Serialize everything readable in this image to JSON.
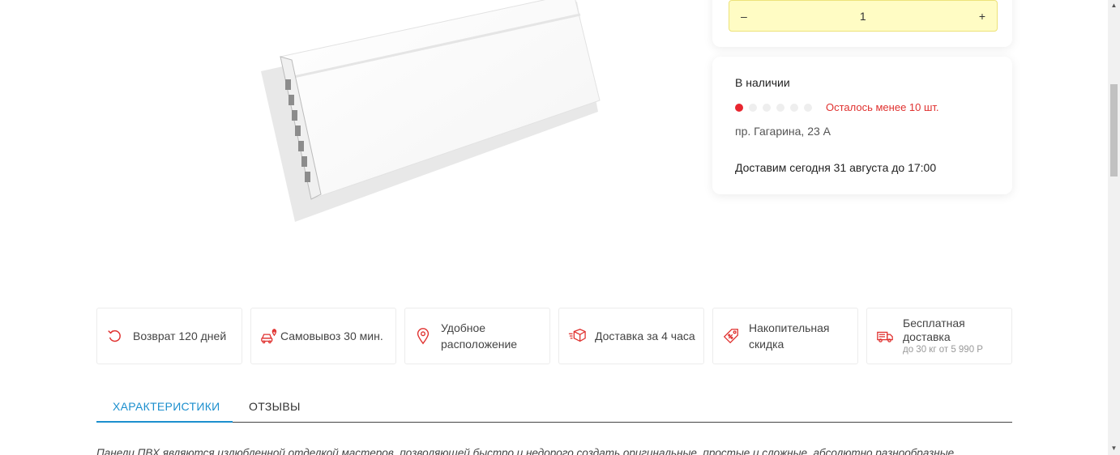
{
  "quantity": {
    "minus_label": "–",
    "value": "1",
    "plus_label": "+"
  },
  "stock": {
    "title": "В наличии",
    "level_dots_total": 6,
    "level_dots_filled": 1,
    "warning": "Осталось менее 10 шт.",
    "address": "пр. Гагарина, 23 А",
    "delivery": "Доставим сегодня 31 августа до 17:00"
  },
  "features": [
    {
      "icon": "return-icon",
      "label": "Возврат 120 дней"
    },
    {
      "icon": "car-pin-icon",
      "label": "Самовывоз 30 мин."
    },
    {
      "icon": "location-pin-icon",
      "label": "Удобное расположение"
    },
    {
      "icon": "box-fast-icon",
      "label": "Доставка за 4 часа"
    },
    {
      "icon": "discount-tag-icon",
      "label": "Накопительная скидка"
    },
    {
      "icon": "truck-icon",
      "label": "Бесплатная доставка",
      "sub": "до 30 кг от 5 990 Р"
    }
  ],
  "tabs": [
    {
      "label": "ХАРАКТЕРИСТИКИ",
      "active": true
    },
    {
      "label": "ОТЗЫВЫ",
      "active": false
    }
  ],
  "description": "Панели ПВХ являются излюбленной отделкой мастеров, позволяющей быстро и недорого создать оригинальные, простые и сложные, абсолютно разнообразные",
  "colors": {
    "accent": "#1c8fce",
    "warning": "#e0312f",
    "qty_bg": "#fffcc4"
  }
}
